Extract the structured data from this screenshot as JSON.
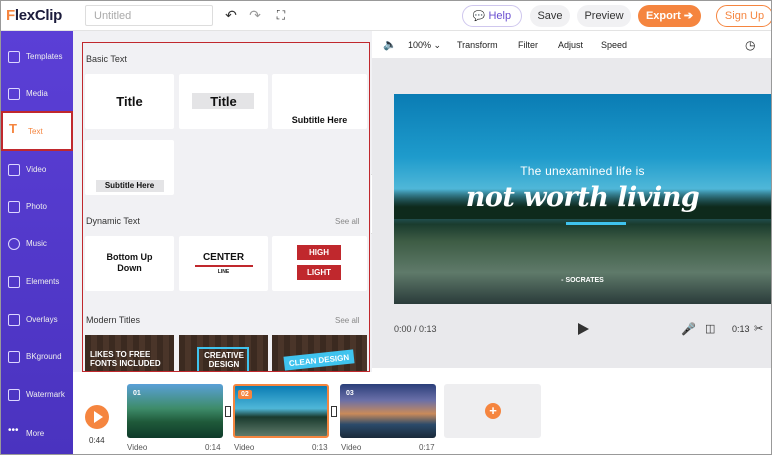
{
  "app": {
    "logo": "FlexClip",
    "title_placeholder": "Untitled"
  },
  "topbar": {
    "help": "Help",
    "save": "Save",
    "preview": "Preview",
    "export": "Export",
    "signup": "Sign Up"
  },
  "nav": [
    {
      "label": "Templates",
      "icon": "templates-icon"
    },
    {
      "label": "Media",
      "icon": "media-icon"
    },
    {
      "label": "Text",
      "icon": "text-icon"
    },
    {
      "label": "Video",
      "icon": "video-icon"
    },
    {
      "label": "Photo",
      "icon": "photo-icon"
    },
    {
      "label": "Music",
      "icon": "music-icon"
    },
    {
      "label": "Elements",
      "icon": "elements-icon"
    },
    {
      "label": "Overlays",
      "icon": "overlays-icon"
    },
    {
      "label": "BKground",
      "icon": "background-icon"
    },
    {
      "label": "Watermark",
      "icon": "watermark-icon"
    },
    {
      "label": "More",
      "icon": "more-icon"
    }
  ],
  "panel": {
    "basic_heading": "Basic Text",
    "basic_cards": [
      "Title",
      "Title",
      "Subtitle Here",
      "Subtitle Here"
    ],
    "dynamic_heading": "Dynamic Text",
    "dynamic_see_all": "See all",
    "dynamic_cards": {
      "bottom_up": "Bottom Up Down",
      "center": "CENTER",
      "center_sub": "LINE",
      "high": "HIGH",
      "light": "LIGHT"
    },
    "modern_heading": "Modern Titles",
    "modern_see_all": "See all",
    "modern_cards": [
      "LIKES TO FREE FONTS INCLUDED",
      "CREATIVE DESIGN",
      "CLEAN DESIGN"
    ]
  },
  "editor": {
    "zoom": "100%",
    "transform": "Transform",
    "filter": "Filter",
    "adjust": "Adjust",
    "speed": "Speed"
  },
  "video": {
    "line1": "The unexamined life is",
    "line2": "not worth living",
    "author": "- SOCRATES",
    "time_current": "0:00 / 0:13",
    "time_end": "0:13"
  },
  "timeline": {
    "total": "0:44",
    "clips": [
      {
        "num": "01",
        "type": "Video",
        "duration": "0:14"
      },
      {
        "num": "02",
        "type": "Video",
        "duration": "0:13"
      },
      {
        "num": "03",
        "type": "Video",
        "duration": "0:17"
      }
    ]
  },
  "colors": {
    "accent": "#f5853f",
    "nav": "#5b3fd6",
    "highlight": "#c0282d"
  }
}
